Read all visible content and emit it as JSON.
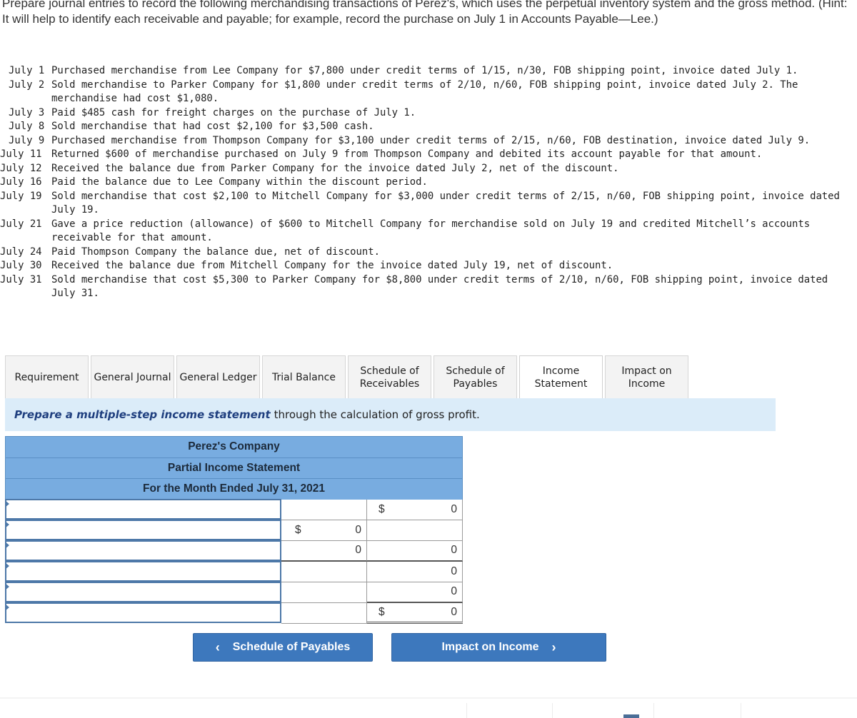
{
  "intro": "Prepare journal entries to record the following merchandising transactions of Perez's, which uses the perpetual inventory system and the gross method. (Hint: It will help to identify each receivable and payable; for example, record the purchase on July 1 in Accounts Payable—Lee.)",
  "transactions": [
    {
      "date": "July 1",
      "text": "Purchased merchandise from Lee Company for $7,800 under credit terms of 1/15, n/30, FOB shipping point, invoice dated July 1."
    },
    {
      "date": "July 2",
      "text": "Sold merchandise to Parker Company for $1,800 under credit terms of 2/10, n/60, FOB shipping point, invoice dated July 2. The merchandise had cost $1,080."
    },
    {
      "date": "July 3",
      "text": "Paid $485 cash for freight charges on the purchase of July 1."
    },
    {
      "date": "July 8",
      "text": "Sold merchandise that had cost $2,100 for $3,500 cash."
    },
    {
      "date": "July 9",
      "text": "Purchased merchandise from Thompson Company for $3,100 under credit terms of 2/15, n/60, FOB destination, invoice dated July 9."
    },
    {
      "date": "July 11",
      "text": "Returned $600 of merchandise purchased on July 9 from Thompson Company and debited its account payable for that amount."
    },
    {
      "date": "July 12",
      "text": "Received the balance due from Parker Company for the invoice dated July 2, net of the discount."
    },
    {
      "date": "July 16",
      "text": "Paid the balance due to Lee Company within the discount period."
    },
    {
      "date": "July 19",
      "text": "Sold merchandise that cost $2,100 to Mitchell Company for $3,000 under credit terms of 2/15, n/60, FOB shipping point, invoice dated July 19."
    },
    {
      "date": "July 21",
      "text": "Gave a price reduction (allowance) of $600 to Mitchell Company for merchandise sold on July 19 and credited Mitchell’s accounts receivable for that amount."
    },
    {
      "date": "July 24",
      "text": "Paid Thompson Company the balance due, net of discount."
    },
    {
      "date": "July 30",
      "text": "Received the balance due from Mitchell Company for the invoice dated July 19, net of discount."
    },
    {
      "date": "July 31",
      "text": "Sold merchandise that cost $5,300 to Parker Company for $8,800 under credit terms of 2/10, n/60, FOB shipping point, invoice dated July 31."
    }
  ],
  "tabs": [
    {
      "label": "Requirement",
      "active": false
    },
    {
      "label": "General Journal",
      "active": false
    },
    {
      "label": "General Ledger",
      "active": false
    },
    {
      "label": "Trial Balance",
      "active": false
    },
    {
      "label": "Schedule of Receivables",
      "active": false
    },
    {
      "label": "Schedule of Payables",
      "active": false
    },
    {
      "label": "Income Statement",
      "active": true
    },
    {
      "label": "Impact on Income",
      "active": false
    }
  ],
  "instruction": {
    "emphasis": "Prepare a multiple-step income statement",
    "rest": "through the calculation of gross profit."
  },
  "statement": {
    "company": "Perez's Company",
    "title": "Partial Income Statement",
    "period": "For the Month Ended July 31, 2021",
    "rows": [
      {
        "account": "",
        "col1_dollar": "",
        "col1": "",
        "col2_dollar": "$",
        "col2": "0"
      },
      {
        "account": "",
        "col1_dollar": "$",
        "col1": "0",
        "col2_dollar": "",
        "col2": ""
      },
      {
        "account": "",
        "col1_dollar": "",
        "col1": "0",
        "col2_dollar": "",
        "col2": "0"
      },
      {
        "account": "",
        "col1_dollar": "",
        "col1": "",
        "col2_dollar": "",
        "col2": "0"
      },
      {
        "account": "",
        "col1_dollar": "",
        "col1": "",
        "col2_dollar": "",
        "col2": "0"
      },
      {
        "account": "",
        "col1_dollar": "",
        "col1": "",
        "col2_dollar": "$",
        "col2": "0"
      }
    ]
  },
  "nav": {
    "prev_label": "Schedule of Payables",
    "prev_icon": "‹",
    "next_label": "Impact on Income",
    "next_icon": "›"
  }
}
